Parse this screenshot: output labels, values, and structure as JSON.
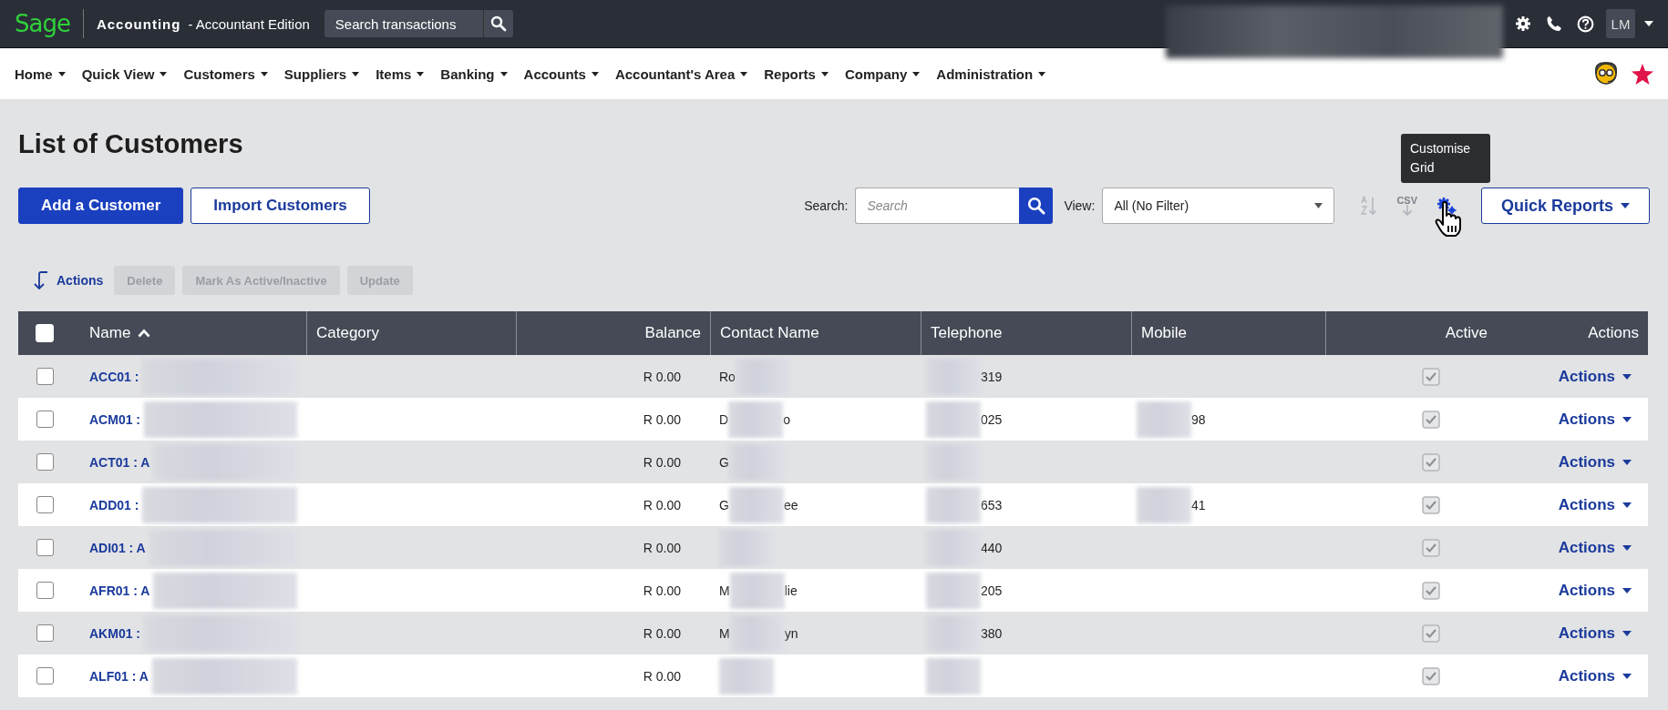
{
  "topbar": {
    "logo": "Sage",
    "product": "Accounting",
    "edition": "- Accountant Edition",
    "search_placeholder": "Search transactions",
    "avatar": "LM"
  },
  "nav": [
    {
      "label": "Home"
    },
    {
      "label": "Quick View"
    },
    {
      "label": "Customers"
    },
    {
      "label": "Suppliers"
    },
    {
      "label": "Items"
    },
    {
      "label": "Banking"
    },
    {
      "label": "Accounts"
    },
    {
      "label": "Accountant's Area"
    },
    {
      "label": "Reports"
    },
    {
      "label": "Company"
    },
    {
      "label": "Administration"
    }
  ],
  "page_title": "List of Customers",
  "buttons": [
    {
      "label": "Add a Customer",
      "kind": "primary"
    },
    {
      "label": "Import Customers",
      "kind": "secondary"
    }
  ],
  "search": {
    "label": "Search:",
    "placeholder": "Search"
  },
  "view": {
    "label": "View:",
    "value": "All (No Filter)"
  },
  "csv_label": "CSV",
  "tooltip": "Customise Grid",
  "quick_reports": "Quick Reports",
  "actions_bar": {
    "label": "Actions",
    "buttons": [
      {
        "label": "Delete",
        "disabled": true
      },
      {
        "label": "Mark As Active/Inactive",
        "disabled": true
      },
      {
        "label": "Update",
        "disabled": true
      }
    ]
  },
  "table": {
    "header_checked": false,
    "columns": [
      {
        "label": "Name",
        "sorted": true
      },
      {
        "label": "Category",
        "sorted": false
      },
      {
        "label": "Balance",
        "sorted": false
      },
      {
        "label": "Contact Name",
        "sorted": false
      },
      {
        "label": "Telephone",
        "sorted": false
      },
      {
        "label": "Mobile",
        "sorted": false
      },
      {
        "label": "Active",
        "sorted": false
      },
      {
        "label": "Actions",
        "sorted": false
      }
    ],
    "rows": [
      {
        "checked": false,
        "name": "ACC01 :",
        "balance": "R 0.00",
        "contact": {
          "start": "Ro"
        },
        "telephone": {
          "end": "319"
        },
        "active": true,
        "action": "Actions"
      },
      {
        "checked": false,
        "name": "ACM01 :",
        "balance": "R 0.00",
        "contact": {
          "start": "D",
          "end": "o"
        },
        "telephone": {
          "end": "025"
        },
        "mobile": {
          "end": "98"
        },
        "active": true,
        "action": "Actions"
      },
      {
        "checked": false,
        "name": "ACT01 : A",
        "balance": "R 0.00",
        "contact": {
          "start": "G"
        },
        "active": true,
        "action": "Actions"
      },
      {
        "checked": false,
        "name": "ADD01 :",
        "balance": "R 0.00",
        "contact": {
          "start": "G",
          "end": "ee"
        },
        "telephone": {
          "end": "653"
        },
        "mobile": {
          "end": "41"
        },
        "active": true,
        "action": "Actions"
      },
      {
        "checked": false,
        "name": "ADI01 : A",
        "balance": "R 0.00",
        "telephone": {
          "end": "440"
        },
        "active": true,
        "action": "Actions"
      },
      {
        "checked": false,
        "name": "AFR01 : A",
        "balance": "R 0.00",
        "contact": {
          "start": "M",
          "end": "lie"
        },
        "telephone": {
          "end": "205"
        },
        "active": true,
        "action": "Actions"
      },
      {
        "checked": false,
        "name": "AKM01 :",
        "balance": "R 0.00",
        "contact": {
          "start": "M",
          "end": "yn"
        },
        "telephone": {
          "end": "380"
        },
        "active": true,
        "action": "Actions"
      },
      {
        "checked": false,
        "name": "ALF01 : A",
        "balance": "R 0.00",
        "active": true,
        "action": "Actions"
      }
    ]
  }
}
